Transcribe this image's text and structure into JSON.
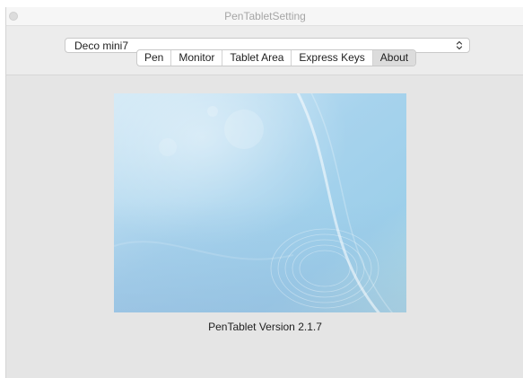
{
  "window": {
    "title": "PenTabletSetting"
  },
  "device_select": {
    "value": "Deco mini7",
    "icon": "chevron-up-down-icon"
  },
  "tabs": [
    {
      "label": "Pen",
      "selected": false
    },
    {
      "label": "Monitor",
      "selected": false
    },
    {
      "label": "Tablet Area",
      "selected": false
    },
    {
      "label": "Express Keys",
      "selected": false
    },
    {
      "label": "About",
      "selected": true
    }
  ],
  "about": {
    "version_label": "PenTablet Version",
    "version_number": "2.1.7"
  },
  "colors": {
    "window_bg": "#e6e6e6",
    "image_light": "#cde6f4",
    "image_mid": "#9fd0ea",
    "image_aqua": "#b5e2e2"
  }
}
